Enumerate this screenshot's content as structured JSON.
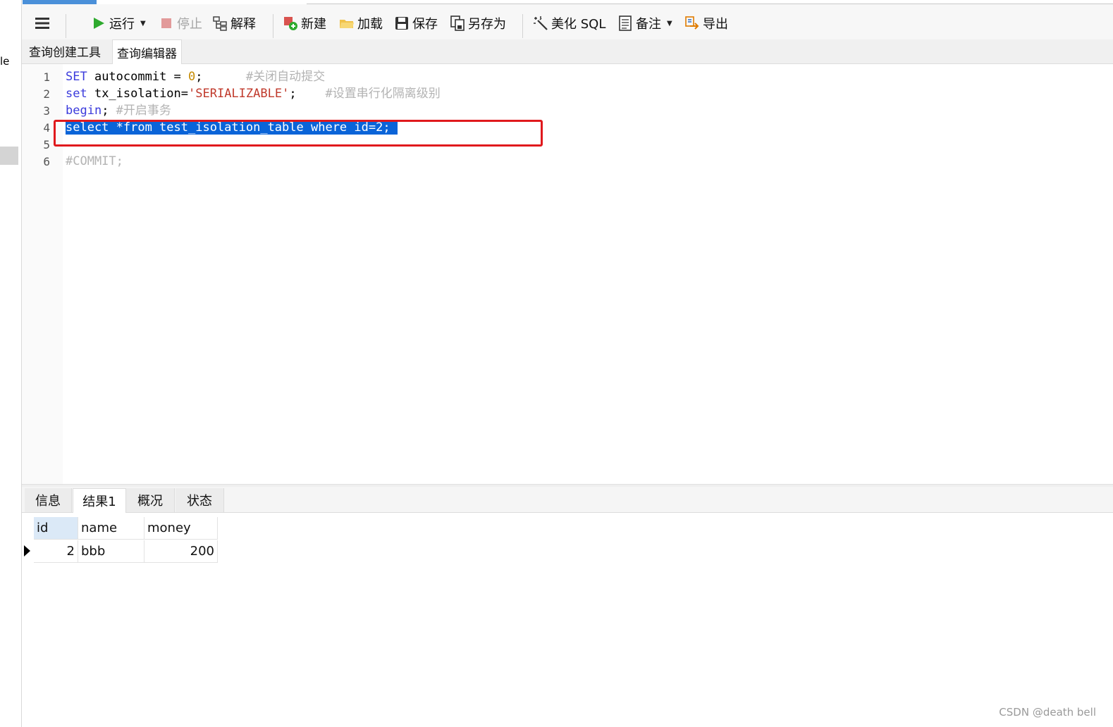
{
  "sidebar_fragment": {
    "text": "le"
  },
  "toolbar": {
    "items": [
      {
        "label": "运行",
        "icon": "play-icon",
        "has_dropdown": true,
        "enabled": true
      },
      {
        "label": "停止",
        "icon": "stop-icon",
        "enabled": false
      },
      {
        "label": "解释",
        "icon": "explain-icon",
        "enabled": true
      },
      {
        "label": "新建",
        "icon": "new-query-icon",
        "enabled": true
      },
      {
        "label": "加载",
        "icon": "folder-open-icon",
        "enabled": true
      },
      {
        "label": "保存",
        "icon": "save-icon",
        "enabled": true
      },
      {
        "label": "另存为",
        "icon": "save-as-icon",
        "enabled": true
      },
      {
        "label": "美化 SQL",
        "icon": "magic-wand-icon",
        "enabled": true
      },
      {
        "label": "备注",
        "icon": "note-icon",
        "has_dropdown": true,
        "enabled": true
      },
      {
        "label": "导出",
        "icon": "export-icon",
        "enabled": true
      }
    ]
  },
  "editor_tabs": [
    {
      "label": "查询创建工具",
      "active": false
    },
    {
      "label": "查询编辑器",
      "active": true
    }
  ],
  "editor": {
    "lines": [
      {
        "num": "1",
        "parts": [
          [
            "kw",
            "SET"
          ],
          [
            "plain",
            " autocommit = "
          ],
          [
            "num",
            "0"
          ],
          [
            "plain",
            ";      "
          ],
          [
            "cm",
            "#关闭自动提交"
          ]
        ]
      },
      {
        "num": "2",
        "parts": [
          [
            "kw",
            "set"
          ],
          [
            "plain",
            " tx_isolation="
          ],
          [
            "str",
            "'SERIALIZABLE'"
          ],
          [
            "plain",
            ";    "
          ],
          [
            "cm",
            "#设置串行化隔离级别"
          ]
        ]
      },
      {
        "num": "3",
        "parts": [
          [
            "kw",
            "begin"
          ],
          [
            "plain",
            "; "
          ],
          [
            "cm",
            "#开启事务"
          ]
        ]
      },
      {
        "num": "4",
        "parts": [
          [
            "sel",
            "select *from test_isolation_table where id=2; "
          ]
        ]
      },
      {
        "num": "5",
        "parts": []
      },
      {
        "num": "6",
        "parts": [
          [
            "cm",
            "#COMMIT;"
          ]
        ]
      }
    ],
    "colors": {
      "keyword": "#3b3bdc",
      "number": "#c58a00",
      "string": "#c0392b",
      "comment": "#b3b3b3",
      "selection": "#0a64d8",
      "highlight_box": "#e0191d"
    }
  },
  "result_tabs": [
    {
      "label": "信息",
      "active": false
    },
    {
      "label": "结果1",
      "active": true
    },
    {
      "label": "概况",
      "active": false
    },
    {
      "label": "状态",
      "active": false
    }
  ],
  "result_grid": {
    "columns": [
      "id",
      "name",
      "money"
    ],
    "rows": [
      [
        "2",
        "bbb",
        "200"
      ]
    ]
  },
  "watermark": "CSDN @death bell"
}
